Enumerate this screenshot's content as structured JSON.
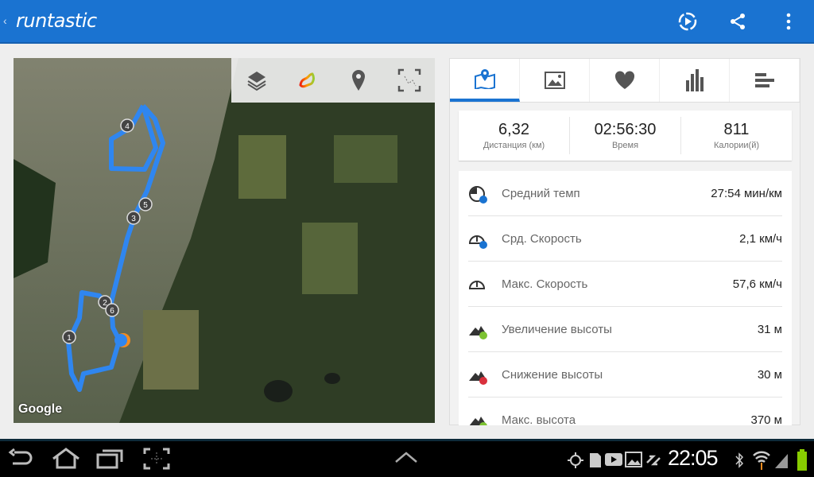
{
  "header": {
    "back": "‹",
    "logo": "runtastic",
    "icons": [
      "video-play-icon",
      "share-icon",
      "overflow-menu-icon"
    ]
  },
  "map": {
    "attribution": "Google",
    "tools": [
      "layers-icon",
      "route-color-icon",
      "pin-icon",
      "fit-route-icon"
    ],
    "markers": [
      "1",
      "2",
      "3",
      "4",
      "5",
      "6"
    ]
  },
  "tabs": [
    "map-tab",
    "photos-tab",
    "heart-rate-tab",
    "charts-tab",
    "splits-tab"
  ],
  "summary": [
    {
      "value": "6,32",
      "label": "Дистанция (км)"
    },
    {
      "value": "02:56:30",
      "label": "Время"
    },
    {
      "value": "811",
      "label": "Калории(й)"
    }
  ],
  "stats": [
    {
      "label": "Средний темп",
      "value": "27:54 мин/км",
      "icon": "avg-pace-icon"
    },
    {
      "label": "Срд. Скорость",
      "value": "2,1 км/ч",
      "icon": "avg-speed-icon"
    },
    {
      "label": "Макс. Скорость",
      "value": "57,6 км/ч",
      "icon": "max-speed-icon"
    },
    {
      "label": "Увеличение высоты",
      "value": "31 м",
      "icon": "elevation-gain-icon"
    },
    {
      "label": "Снижение высоты",
      "value": "30 м",
      "icon": "elevation-loss-icon"
    },
    {
      "label": "Макс. высота",
      "value": "370 м",
      "icon": "max-elevation-icon"
    }
  ],
  "statusbar": {
    "time": "22:05"
  },
  "colors": {
    "accent": "#1a73d1",
    "route": "#2f86f0"
  }
}
